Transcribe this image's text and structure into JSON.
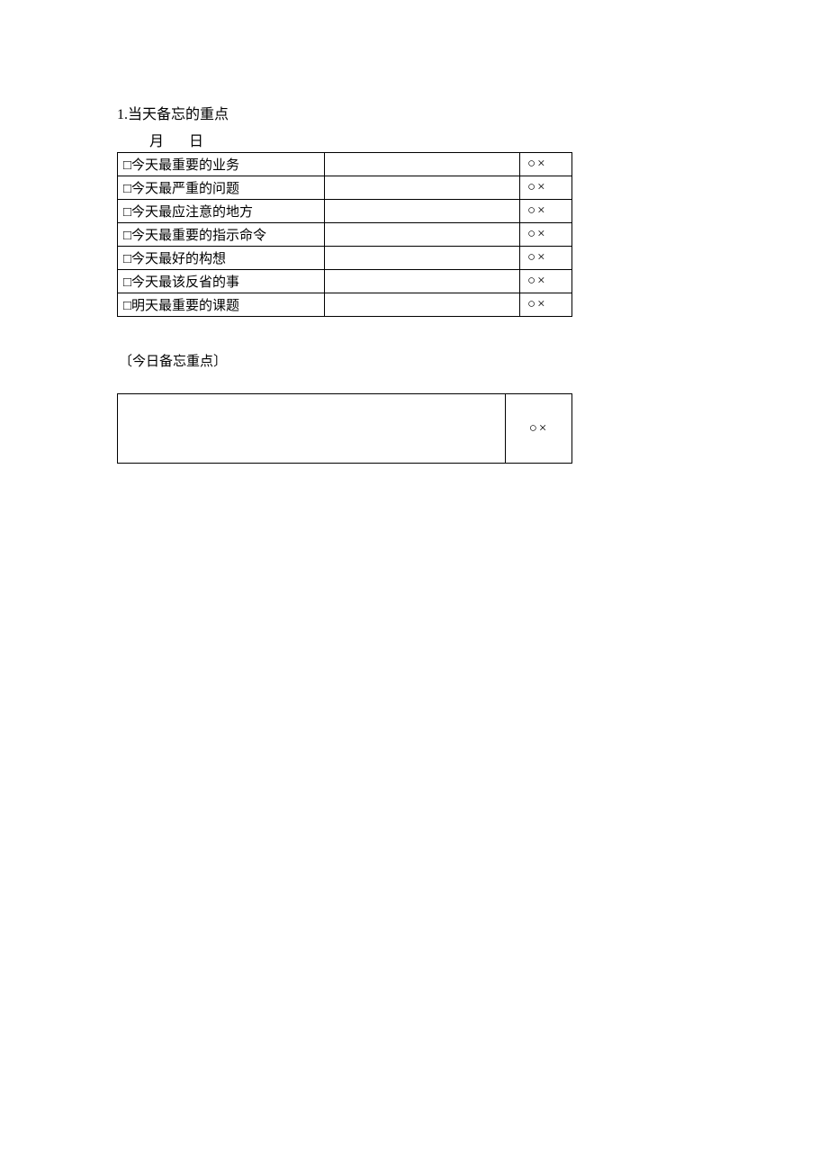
{
  "title": "1.当天备忘的重点",
  "date": {
    "month_label": "月",
    "day_label": "日"
  },
  "mark": "○×",
  "rows": [
    {
      "label": "□今天最重要的业务",
      "value": "",
      "mark": "○×"
    },
    {
      "label": "□今天最严重的问题",
      "value": "",
      "mark": "○×"
    },
    {
      "label": "□今天最应注意的地方",
      "value": "",
      "mark": "○×"
    },
    {
      "label": "□今天最重要的指示命令",
      "value": "",
      "mark": "○×"
    },
    {
      "label": "□今天最好的构想",
      "value": "",
      "mark": "○×"
    },
    {
      "label": "□今天最该反省的事",
      "value": "",
      "mark": "○×"
    },
    {
      "label": "□明天最重要的课题",
      "value": "",
      "mark": "○×"
    }
  ],
  "sub_title": "〔今日备忘重点〕",
  "memo": {
    "content": "",
    "mark": "○×"
  }
}
